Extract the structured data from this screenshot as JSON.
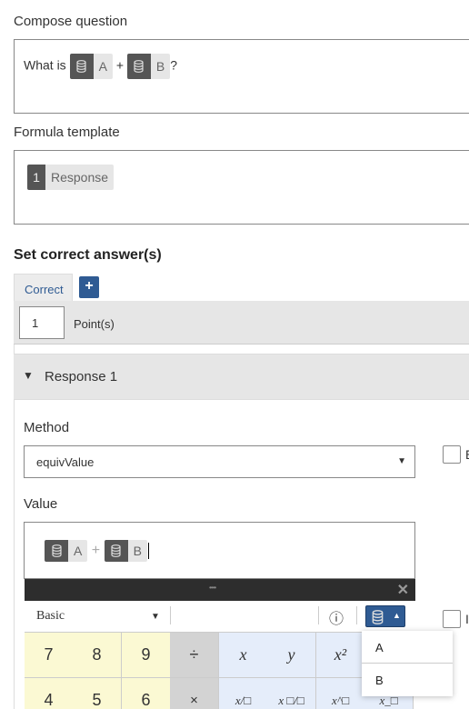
{
  "compose": {
    "label": "Compose question",
    "prefix": "What is",
    "var_a": "A",
    "plus": "+",
    "var_b": "B",
    "suffix": "?"
  },
  "template": {
    "label": "Formula template",
    "index": "1",
    "response": "Response"
  },
  "answers": {
    "heading": "Set correct answer(s)",
    "tab": "Correct",
    "add_icon": "plus-icon",
    "points_value": "1",
    "points_label": "Point(s)"
  },
  "response": {
    "title": "Response 1",
    "method_label": "Method",
    "method_value": "equivValue",
    "value_label": "Value",
    "value_a": "A",
    "value_plus": "+",
    "value_b": "B",
    "checkbox1_label": "E",
    "checkbox2_label": "I"
  },
  "keypad": {
    "mode": "Basic",
    "handle": "••••",
    "close": "✕",
    "info": "ⓘ",
    "row1": [
      "7",
      "8",
      "9",
      "÷",
      "x",
      "y",
      "x²"
    ],
    "row2": [
      "4",
      "5",
      "6",
      "×",
      "x/□",
      "x □/□",
      "x^□",
      "x_□"
    ]
  },
  "variable_menu": {
    "items": [
      "A",
      "B"
    ]
  },
  "colors": {
    "accent": "#2f5b93",
    "chip_dark": "#555555",
    "num_key": "#fbf9d3",
    "var_key": "#e5edfa"
  }
}
